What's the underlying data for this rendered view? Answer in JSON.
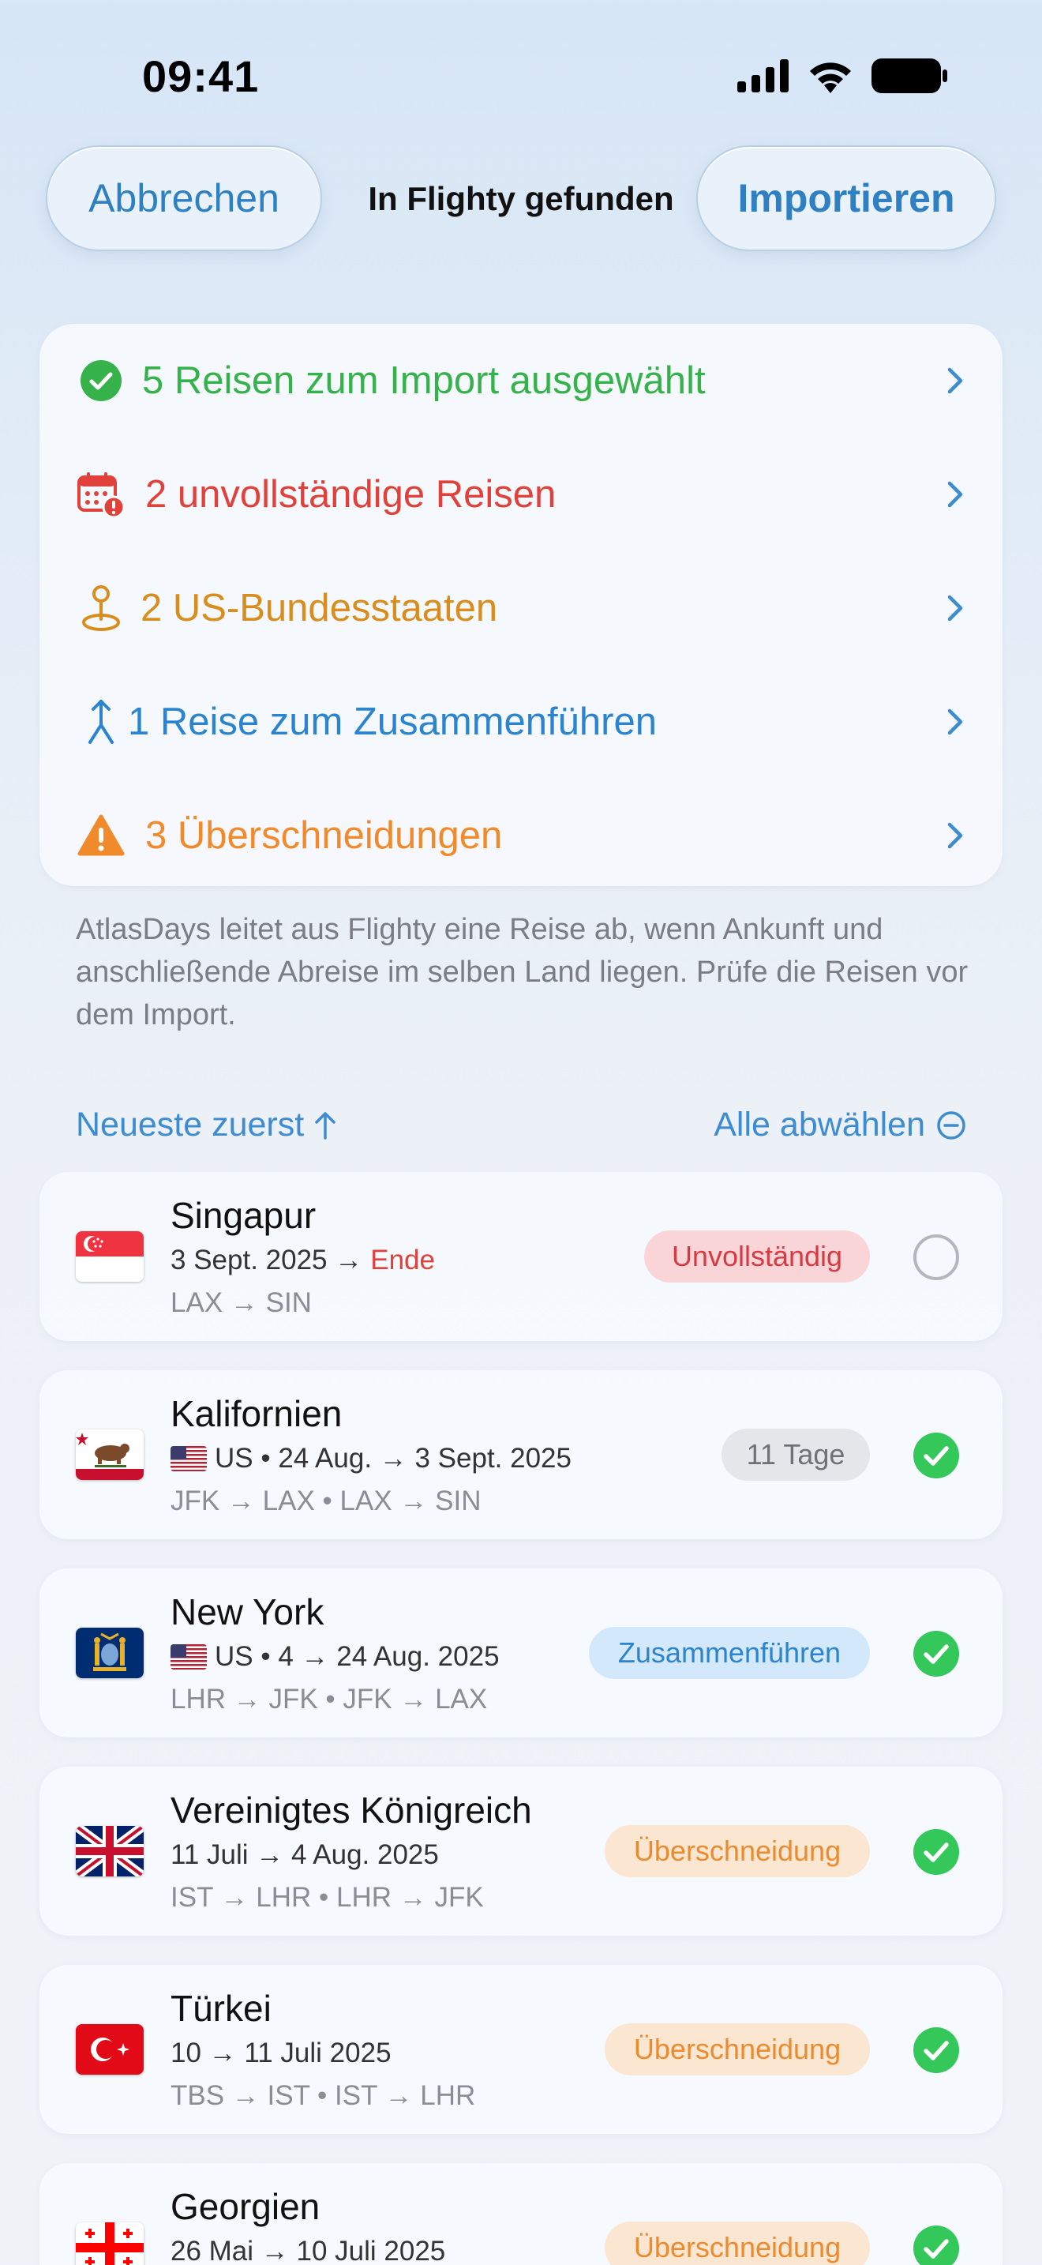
{
  "status_bar": {
    "time": "09:41"
  },
  "nav": {
    "cancel_label": "Abbrechen",
    "title": "In Flighty gefunden",
    "import_label": "Importieren"
  },
  "summary": {
    "rows": [
      {
        "label": "5 Reisen zum Import ausgewählt",
        "icon": "checkmark-circle-icon",
        "color": "#35b34a"
      },
      {
        "label": "2 unvollständige Reisen",
        "icon": "calendar-alert-icon",
        "color": "#e0413a"
      },
      {
        "label": "2 US-Bundesstaaten",
        "icon": "map-pin-icon",
        "color": "#d98d1c"
      },
      {
        "label": "1 Reise zum Zusammenführen",
        "icon": "merge-arrow-icon",
        "color": "#2a84cf"
      },
      {
        "label": "3 Überschneidungen",
        "icon": "warning-triangle-icon",
        "color": "#f18a2a"
      }
    ]
  },
  "explainer": "AtlasDays leitet aus Flighty eine Reise ab, wenn Ankunft und anschließende Abreise im selben Land liegen. Prüfe die Reisen vor dem Import.",
  "list_controls": {
    "sort_label": "Neueste zuerst",
    "deselect_label": "Alle abwählen"
  },
  "trips": [
    {
      "name": "Singapur",
      "dates": "3 Sept. 2025 →",
      "end_label": "Ende",
      "route": "LAX → SIN",
      "badge": "Unvollständig",
      "selected": false,
      "flag": "singapore-flag"
    },
    {
      "name": "Kalifornien",
      "dates": "US • 24 Aug. → 3 Sept. 2025",
      "route": "JFK → LAX • LAX → SIN",
      "badge": "11 Tage",
      "selected": true,
      "flag": "california-flag"
    },
    {
      "name": "New York",
      "dates": "US • 4 → 24 Aug. 2025",
      "route": "LHR → JFK • JFK → LAX",
      "badge": "Zusammenführen",
      "selected": true,
      "flag": "new-york-flag"
    },
    {
      "name": "Vereinigtes Königreich",
      "dates": "11 Juli → 4 Aug. 2025",
      "route": "IST → LHR • LHR → JFK",
      "badge": "Überschneidung",
      "selected": true,
      "flag": "uk-flag"
    },
    {
      "name": "Türkei",
      "dates": "10 → 11 Juli 2025",
      "route": "TBS → IST • IST → LHR",
      "badge": "Überschneidung",
      "selected": true,
      "flag": "turkey-flag"
    },
    {
      "name": "Georgien",
      "dates": "26 Mai → 10 Juli 2025",
      "badge": "Überschneidung",
      "selected": true,
      "flag": "georgia-flag"
    }
  ]
}
